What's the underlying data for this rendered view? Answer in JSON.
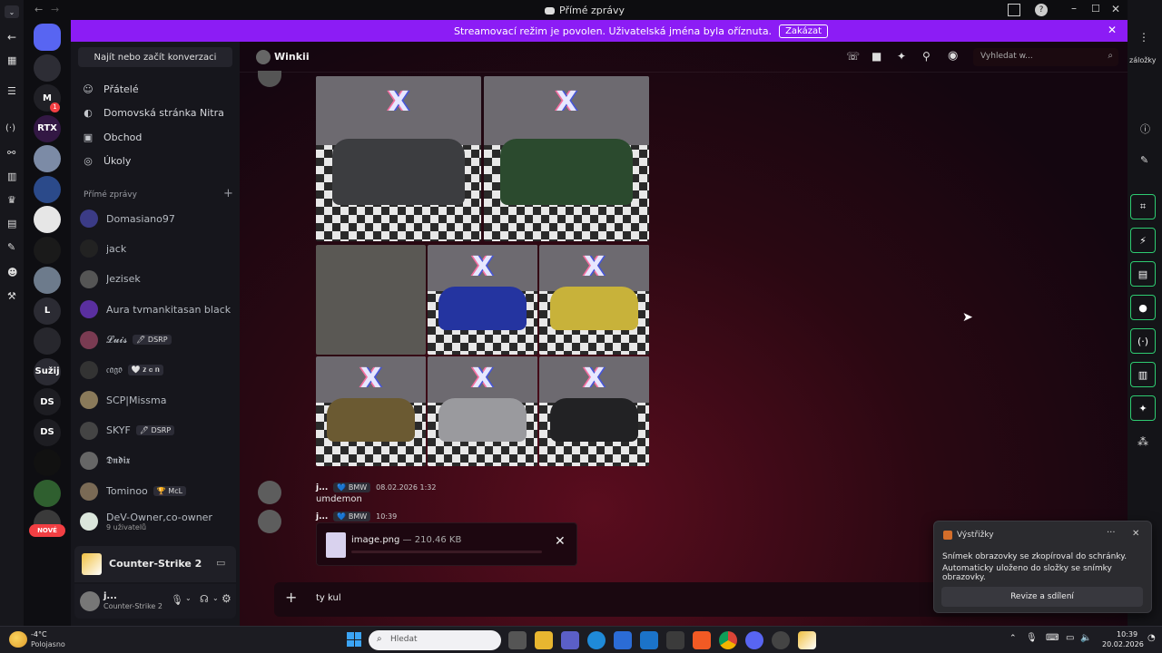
{
  "window": {
    "title": "Přímé zprávy"
  },
  "banner": {
    "text": "Streamovací režim je povolen. Uživatelská jména byla oříznuta.",
    "button": "Zakázat"
  },
  "guilds": [
    {
      "label": "",
      "color": "#5865f2"
    },
    {
      "label": "",
      "color": "#2d2d35"
    },
    {
      "label": "M",
      "color": "#202026",
      "badge": "1"
    },
    {
      "label": "RTX",
      "color": "#331844"
    },
    {
      "label": "",
      "color": "#7c8ba6"
    },
    {
      "label": "",
      "color": "#2b4a8a"
    },
    {
      "label": "",
      "color": "#e6e6e6"
    },
    {
      "label": "",
      "color": "#1a1a1a"
    },
    {
      "label": "",
      "color": "#6d7b8c"
    },
    {
      "label": "L",
      "color": "#2b2b33"
    },
    {
      "label": "",
      "color": "#27272d"
    },
    {
      "label": "Sužij",
      "color": "#2b2b33"
    },
    {
      "label": "DS",
      "color": "#1d1d22"
    },
    {
      "label": "DS",
      "color": "#1d1d22"
    },
    {
      "label": "",
      "color": "#111"
    },
    {
      "label": "",
      "color": "#2f5f2f"
    },
    {
      "label": "",
      "color": "#3a3a3a"
    }
  ],
  "guild_new_badge": "NOVÉ",
  "channels": {
    "search": "Najít nebo začít konverzaci",
    "nav": [
      {
        "label": "Přátelé",
        "icon": "friends-icon",
        "glyph": "☺"
      },
      {
        "label": "Domovská stránka Nitra",
        "icon": "nitro-icon",
        "glyph": "◐"
      },
      {
        "label": "Obchod",
        "icon": "shop-icon",
        "glyph": "▣"
      },
      {
        "label": "Úkoly",
        "icon": "quests-icon",
        "glyph": "◎"
      }
    ],
    "dm_header": "Přímé zprávy",
    "dms": [
      {
        "name": "Domasiano97",
        "tag": "",
        "color": "#3b3b86"
      },
      {
        "name": "jack",
        "tag": "",
        "color": "#222"
      },
      {
        "name": "Jezisek",
        "tag": "",
        "color": "#555"
      },
      {
        "name": "Aura tvmankitasan black му...",
        "tag": "",
        "color": "#5a2fa0"
      },
      {
        "name": "𝓛𝓾𝓲𝓼",
        "tag": "🖊 DSRP",
        "color": "#7a3b52"
      },
      {
        "name": "𝔠𝔞𝔤𝔬",
        "tag": "🤍 𝐳 𝐜 𝐧",
        "color": "#333"
      },
      {
        "name": "SCP|Missma",
        "tag": "",
        "color": "#8a7a5a"
      },
      {
        "name": "SKYF",
        "tag": "🖊 DSRP",
        "color": "#444"
      },
      {
        "name": "𝕯𝖓𝖉𝖎𝖝",
        "tag": "",
        "color": "#666"
      },
      {
        "name": "Tominoo",
        "tag": "🏆 McL",
        "color": "#7a6a55"
      },
      {
        "name": "DeV-Owner,co-owner",
        "tag": "",
        "color": "#dbe6dc",
        "sub": "9 uživatelů"
      }
    ],
    "activity": "Counter-Strike 2",
    "user": {
      "name": "j...",
      "status": "Counter-Strike 2"
    }
  },
  "chat": {
    "channel": "Winkii",
    "search_placeholder": "Vyhledat w...",
    "messages": [
      {
        "author": "j...",
        "tag": "💙 BMW",
        "time": "08.02.2026 1:32",
        "text": "umdemon"
      },
      {
        "author": "j...",
        "tag": "💙 BMW",
        "time": "10:39",
        "text": ""
      }
    ],
    "attachment": {
      "name": "image.png",
      "size": "— 210.46 KB"
    },
    "input_value": "ty kul"
  },
  "snip": {
    "app": "Výstřižky",
    "text1": "Snímek obrazovky se zkopíroval do schránky.",
    "text2": "Automaticky uloženo do složky se snímky obrazovky.",
    "button": "Revize a sdílení"
  },
  "browser": {
    "right_label": "záložky"
  },
  "taskbar": {
    "weather_temp": "-4°C",
    "weather_text": "Polojasno",
    "search_placeholder": "Hledat",
    "time": "10:39",
    "date": "20.02.2026"
  },
  "colors": {
    "accent": "#8c1cf5",
    "nitro_green": "#2ecc71",
    "chat_bg": "#2a0812"
  }
}
